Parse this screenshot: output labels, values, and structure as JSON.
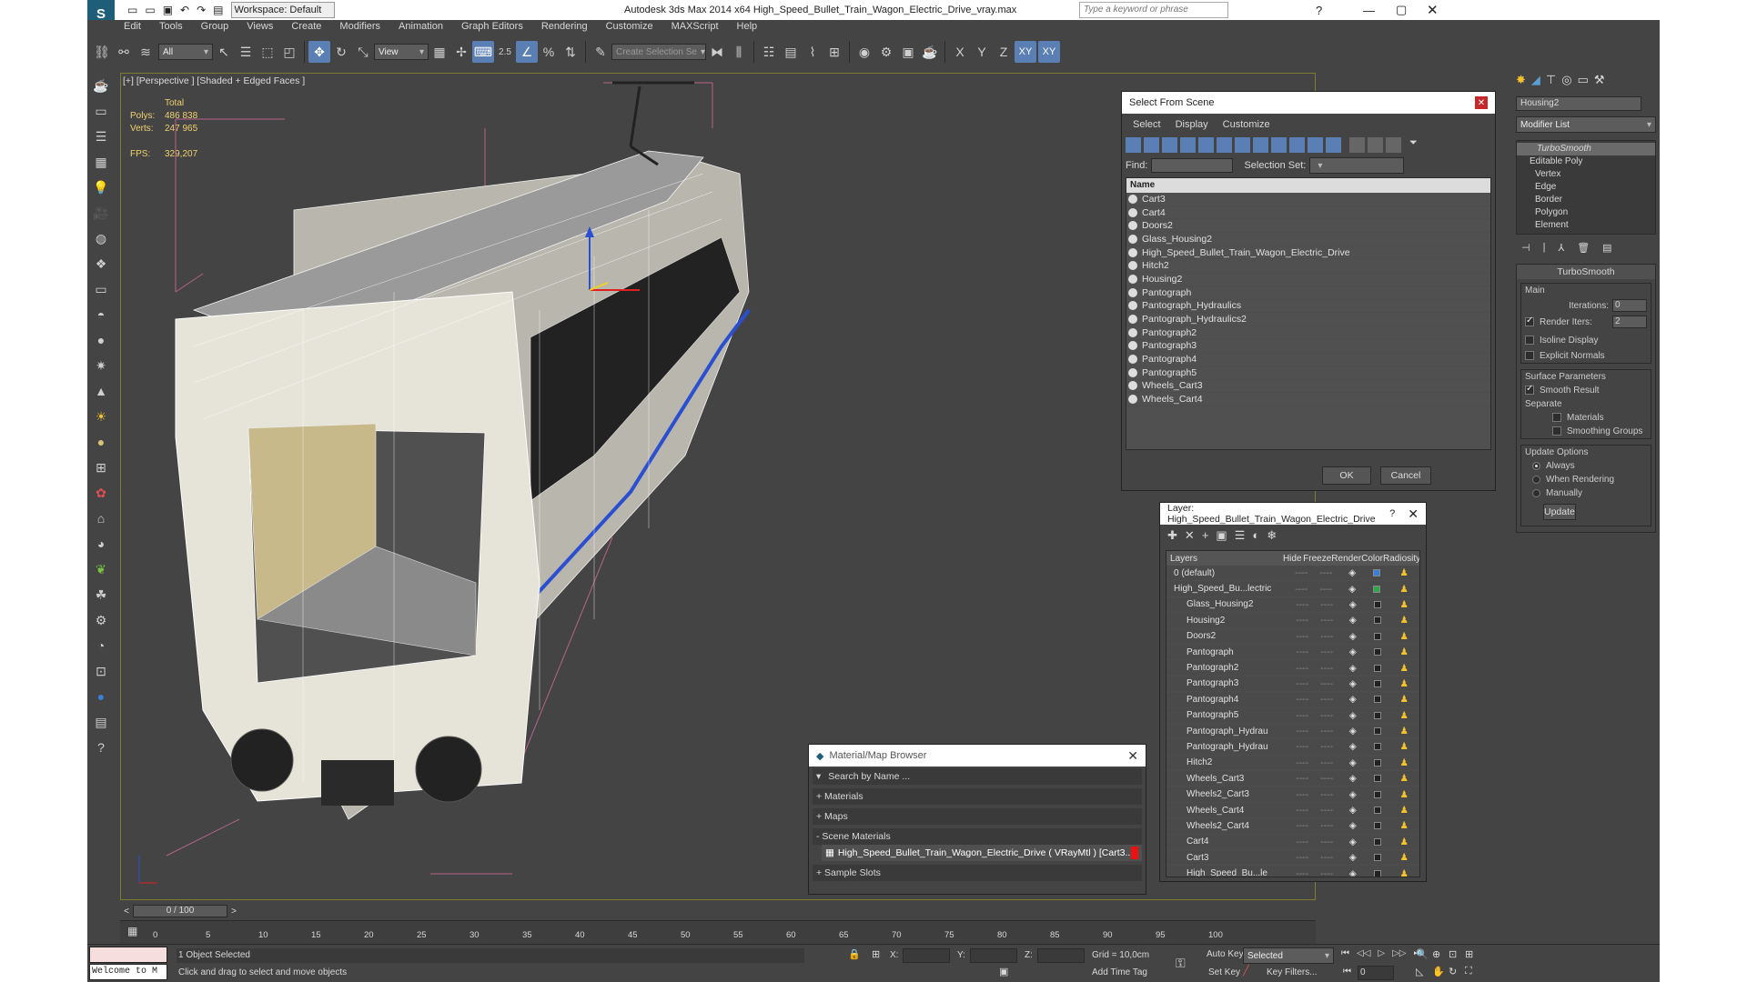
{
  "titlebar": {
    "workspace": "Workspace: Default",
    "app_title": "Autodesk 3ds Max  2014 x64     High_Speed_Bullet_Train_Wagon_Electric_Drive_vray.max",
    "search_placeholder": "Type a keyword or phrase"
  },
  "menu": [
    "Edit",
    "Tools",
    "Group",
    "Views",
    "Create",
    "Modifiers",
    "Animation",
    "Graph Editors",
    "Rendering",
    "Customize",
    "MAXScript",
    "Help"
  ],
  "toolbar": {
    "filter": "All",
    "ref_coord": "View",
    "snap_value": "2.5",
    "named_selection_placeholder": "Create Selection Se",
    "axes": [
      "X",
      "Y",
      "Z",
      "XY",
      "XY"
    ]
  },
  "viewport": {
    "label": "[+] [Perspective ] [Shaded + Edged Faces ]",
    "stats": {
      "header": "Total",
      "polys_label": "Polys:",
      "polys": "486 838",
      "verts_label": "Verts:",
      "verts": "247 965",
      "fps_label": "FPS:",
      "fps": "329,207"
    }
  },
  "select_from_scene": {
    "title": "Select From Scene",
    "menu": [
      "Select",
      "Display",
      "Customize"
    ],
    "find_label": "Find:",
    "selection_set_label": "Selection Set:",
    "column": "Name",
    "items": [
      "Cart3",
      "Cart4",
      "Doors2",
      "Glass_Housing2",
      "High_Speed_Bullet_Train_Wagon_Electric_Drive",
      "Hitch2",
      "Housing2",
      "Pantograph",
      "Pantograph_Hydraulics",
      "Pantograph_Hydraulics2",
      "Pantograph2",
      "Pantograph3",
      "Pantograph4",
      "Pantograph5",
      "Wheels_Cart3",
      "Wheels_Cart4"
    ],
    "ok": "OK",
    "cancel": "Cancel"
  },
  "layer": {
    "title": "Layer: High_Speed_Bullet_Train_Wagon_Electric_Drive",
    "columns": [
      "Layers",
      "Hide",
      "Freeze",
      "Render",
      "Color",
      "Radiosity"
    ],
    "rows": [
      {
        "name": "0 (default)",
        "indent": 0,
        "color": "#3a7fd6"
      },
      {
        "name": "High_Speed_Bu...lectric",
        "indent": 0,
        "color": "#2fa84f"
      },
      {
        "name": "Glass_Housing2",
        "indent": 1,
        "color": "#222222"
      },
      {
        "name": "Housing2",
        "indent": 1,
        "color": "#222222"
      },
      {
        "name": "Doors2",
        "indent": 1,
        "color": "#222222"
      },
      {
        "name": "Pantograph",
        "indent": 1,
        "color": "#222222"
      },
      {
        "name": "Pantograph2",
        "indent": 1,
        "color": "#222222"
      },
      {
        "name": "Pantograph3",
        "indent": 1,
        "color": "#222222"
      },
      {
        "name": "Pantograph4",
        "indent": 1,
        "color": "#222222"
      },
      {
        "name": "Pantograph5",
        "indent": 1,
        "color": "#222222"
      },
      {
        "name": "Pantograph_Hydrau",
        "indent": 1,
        "color": "#222222"
      },
      {
        "name": "Pantograph_Hydrau",
        "indent": 1,
        "color": "#222222"
      },
      {
        "name": "Hitch2",
        "indent": 1,
        "color": "#222222"
      },
      {
        "name": "Wheels_Cart3",
        "indent": 1,
        "color": "#222222"
      },
      {
        "name": "Wheels2_Cart3",
        "indent": 1,
        "color": "#222222"
      },
      {
        "name": "Wheels_Cart4",
        "indent": 1,
        "color": "#222222"
      },
      {
        "name": "Wheels2_Cart4",
        "indent": 1,
        "color": "#222222"
      },
      {
        "name": "Cart4",
        "indent": 1,
        "color": "#222222"
      },
      {
        "name": "Cart3",
        "indent": 1,
        "color": "#222222"
      },
      {
        "name": "High_Speed_Bu...le",
        "indent": 1,
        "color": "#222222"
      }
    ]
  },
  "material_browser": {
    "title": "Material/Map Browser",
    "search_placeholder": "Search by Name ...",
    "sections": [
      "+ Materials",
      "+ Maps",
      "- Scene Materials"
    ],
    "scene_material": "High_Speed_Bullet_Train_Wagon_Electric_Drive  ( VRayMtl )  [Cart3...",
    "sample_slots": "+ Sample Slots"
  },
  "command_panel": {
    "object_name": "Housing2",
    "modifier_list": "Modifier List",
    "stack": [
      "TurboSmooth",
      "Editable Poly",
      "Vertex",
      "Edge",
      "Border",
      "Polygon",
      "Element"
    ],
    "turbosmooth": {
      "rollout": "TurboSmooth",
      "main": "Main",
      "iterations_label": "Iterations:",
      "iterations": "0",
      "render_iters_label": "Render Iters:",
      "render_iters": "2",
      "isoline": "Isoline Display",
      "explicit_normals": "Explicit Normals",
      "surface_params": "Surface Parameters",
      "smooth_result": "Smooth Result",
      "separate": "Separate",
      "materials": "Materials",
      "smoothing_groups": "Smoothing Groups",
      "update_options": "Update Options",
      "always": "Always",
      "when_rendering": "When Rendering",
      "manually": "Manually",
      "update": "Update"
    }
  },
  "timeline": {
    "frame": "0 / 100",
    "ticks": [
      "0",
      "5",
      "10",
      "15",
      "20",
      "25",
      "30",
      "35",
      "40",
      "45",
      "50",
      "55",
      "60",
      "65",
      "70",
      "75",
      "80",
      "85",
      "90",
      "95",
      "100"
    ]
  },
  "status": {
    "welcome": "Welcome to M",
    "selected": "1 Object Selected",
    "prompt": "Click and drag to select and move objects",
    "x_label": "X:",
    "y_label": "Y:",
    "z_label": "Z:",
    "grid": "Grid = 10,0cm",
    "add_time_tag": "Add Time Tag",
    "auto_key": "Auto Key",
    "set_key": "Set Key",
    "key_mode": "Selected",
    "key_filters": "Key Filters...",
    "frame": "0"
  }
}
